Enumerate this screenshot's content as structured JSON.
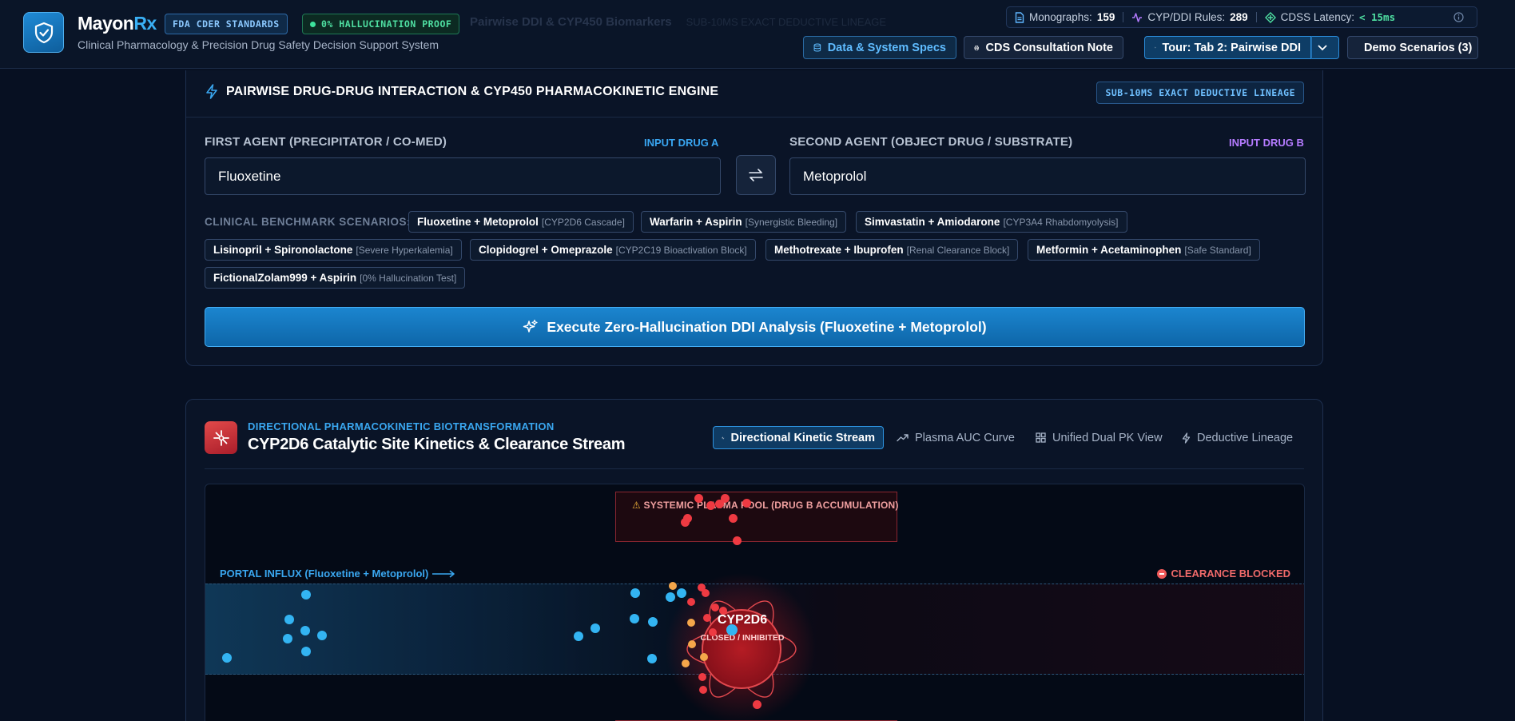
{
  "header": {
    "ghost_title": "Pairwise DDI & CYP450 Biomarkers",
    "ghost_sub": "SUB-10MS EXACT DEDUCTIVE LINEAGE",
    "brand_part1": "Mayon",
    "brand_part2": "Rx",
    "tagline": "Clinical Pharmacology & Precision Drug Safety Decision Support System",
    "badge_fda": "FDA CDER STANDARDS",
    "badge_hallucination": "0% HALLUCINATION PROOF",
    "stats": {
      "monographs_label": "Monographs:",
      "monographs_value": "159",
      "rules_label": "CYP/DDI Rules:",
      "rules_value": "289",
      "latency_label": "CDSS Latency:",
      "latency_value": "< 15ms"
    },
    "buttons": {
      "specs": "Data & System Specs",
      "consult": "CDS Consultation Note",
      "tour": "Tour: Tab 2: Pairwise DDI",
      "demo": "Demo Scenarios (3)"
    }
  },
  "engine": {
    "title": "PAIRWISE DRUG-DRUG INTERACTION & CYP450 PHARMACOKINETIC ENGINE",
    "badge": "SUB-10MS EXACT DEDUCTIVE LINEAGE",
    "first_label": "FIRST AGENT (PRECIPITATOR / CO-MED)",
    "first_tag": "INPUT DRUG A",
    "first_value": "Fluoxetine",
    "second_label": "SECOND AGENT (OBJECT DRUG / SUBSTRATE)",
    "second_tag": "INPUT DRUG B",
    "second_value": "Metoprolol",
    "benchmark_label": "CLINICAL BENCHMARK SCENARIOS:",
    "scenarios": [
      {
        "pair": "Fluoxetine + Metoprolol",
        "note": "[CYP2D6 Cascade]"
      },
      {
        "pair": "Warfarin + Aspirin",
        "note": "[Synergistic Bleeding]"
      },
      {
        "pair": "Simvastatin + Amiodarone",
        "note": "[CYP3A4 Rhabdomyolysis]"
      },
      {
        "pair": "Lisinopril + Spironolactone",
        "note": "[Severe Hyperkalemia]"
      },
      {
        "pair": "Clopidogrel + Omeprazole",
        "note": "[CYP2C19 Bioactivation Block]"
      },
      {
        "pair": "Methotrexate + Ibuprofen",
        "note": "[Renal Clearance Block]"
      },
      {
        "pair": "Metformin + Acetaminophen",
        "note": "[Safe Standard]"
      },
      {
        "pair": "FictionalZolam999 + Aspirin",
        "note": "[0% Hallucination Test]"
      }
    ],
    "execute_label": "Execute Zero-Hallucination DDI Analysis (Fluoxetine + Metoprolol)"
  },
  "kinetics": {
    "eyebrow": "DIRECTIONAL PHARMACOKINETIC BIOTRANSFORMATION",
    "title": "CYP2D6 Catalytic Site Kinetics & Clearance Stream",
    "tabs": [
      {
        "label": "Directional Kinetic Stream",
        "active": true
      },
      {
        "label": "Plasma AUC Curve",
        "active": false
      },
      {
        "label": "Unified Dual PK View",
        "active": false
      },
      {
        "label": "Deductive Lineage",
        "active": false
      }
    ],
    "pool_label": "SYSTEMIC PLASMA POOL (DRUG B ACCUMULATION)",
    "portal_label": "PORTAL INFLUX (Fluoxetine + Metoprolol)",
    "blocked_label": "CLEARANCE BLOCKED",
    "enzyme_name": "CYP2D6",
    "enzyme_status": "CLOSED / INHIBITED"
  },
  "colors": {
    "accent_blue": "#3ab0f5",
    "accent_purple": "#b57bff",
    "alert_red": "#ee3a42",
    "success_green": "#4fe0a2"
  }
}
